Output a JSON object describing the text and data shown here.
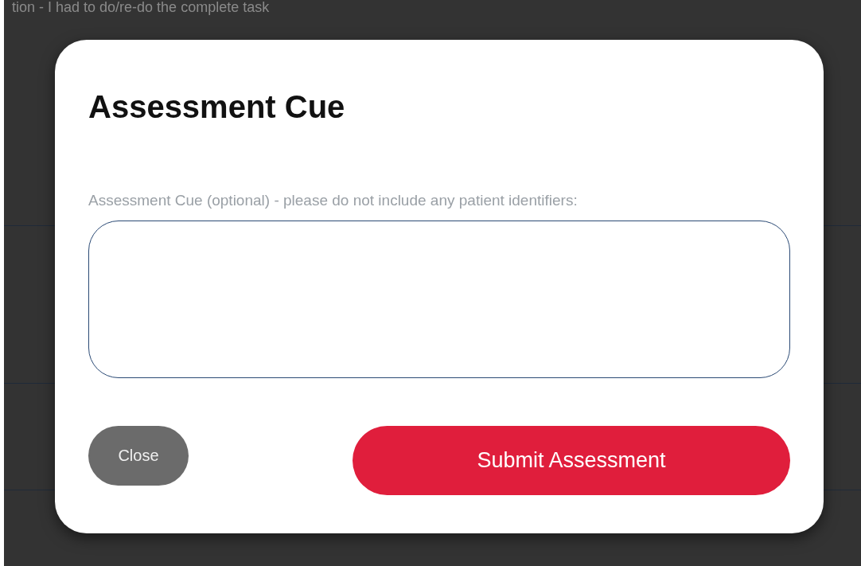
{
  "background": {
    "text": "tion - I had to do/re-do the complete task"
  },
  "modal": {
    "title": "Assessment Cue",
    "field": {
      "label": "Assessment Cue (optional) - please do not include any patient identifiers:"
    },
    "buttons": [
      {
        "label": "Close",
        "kind": "secondary"
      },
      {
        "label": "Submit Assessment",
        "kind": "primary"
      }
    ]
  }
}
